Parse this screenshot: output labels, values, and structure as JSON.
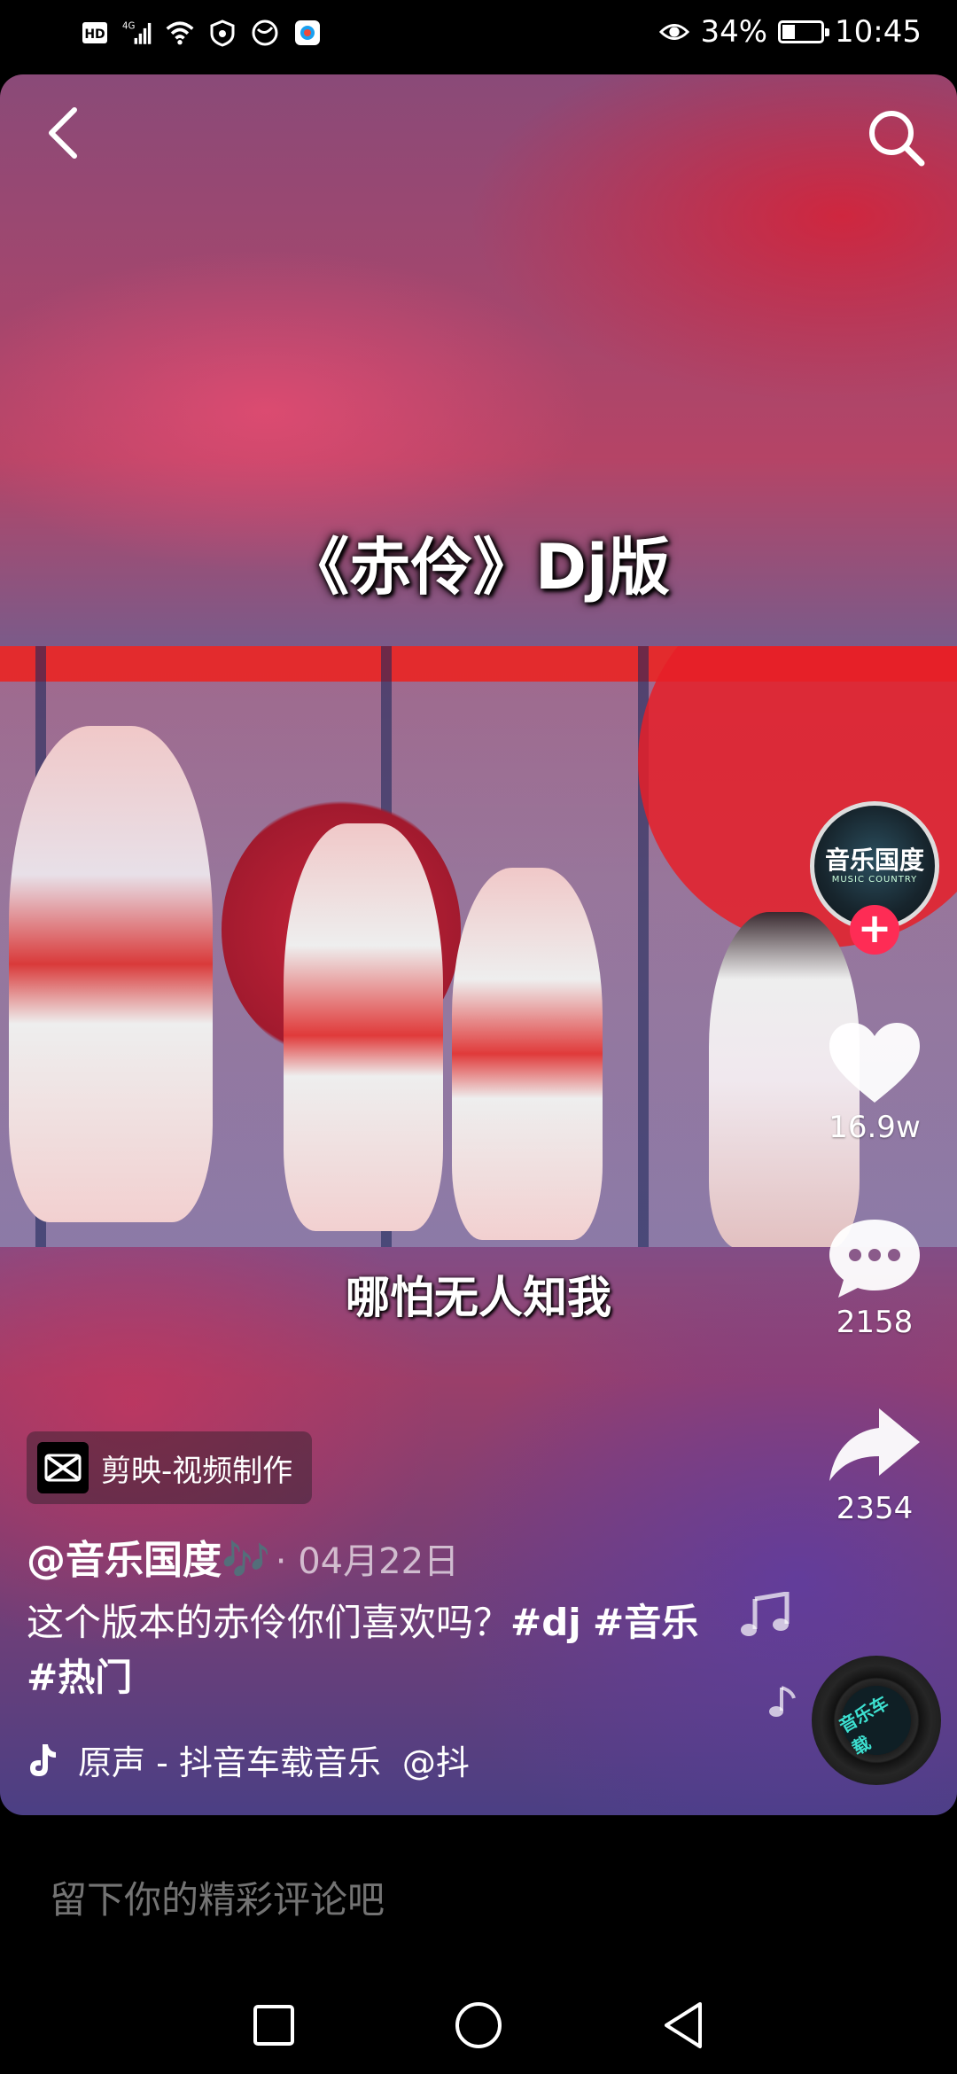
{
  "status_bar": {
    "left_icons": [
      "hd-icon",
      "4g-signal-icon",
      "wifi-icon",
      "vpn-icon",
      "browser-icon",
      "app-icon"
    ],
    "eye_icon": "eye-icon",
    "battery_percent": "34%",
    "battery_level": 0.34,
    "time": "10:45"
  },
  "video": {
    "title_overlay": "《赤伶》Dj版",
    "subtitle": "哪怕无人知我"
  },
  "right_rail": {
    "avatar_text": "音乐国度",
    "avatar_subtext": "MUSIC COUNTRY",
    "follow_symbol": "+",
    "like_count": "16.9w",
    "comment_count": "2158",
    "share_count": "2354",
    "disc_text": "音乐车载"
  },
  "info": {
    "app_tag": "剪映-视频制作",
    "author": "@音乐国度🎶",
    "date": "· 04月22日",
    "caption_text": "这个版本的赤伶你们喜欢吗？",
    "hashtags": [
      "#dj",
      "#音乐",
      "#热门"
    ],
    "music": "原声 - 抖音车载音乐",
    "music_author": "@抖"
  },
  "comment": {
    "placeholder": "留下你的精彩评论吧"
  },
  "colors": {
    "accent": "#fe2c55",
    "background": "#000000"
  }
}
